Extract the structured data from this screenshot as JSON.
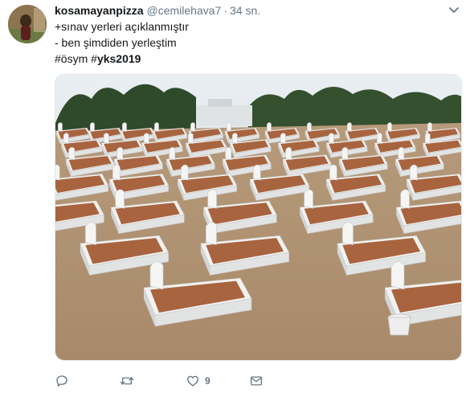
{
  "tweet": {
    "display_name": "kosamayanpizza",
    "handle": "@cemilehava7",
    "separator": "·",
    "time": "34 sn.",
    "lines": [
      "+sınav yerleri açıklanmıştır",
      "- ben şimdiden yerleştim"
    ],
    "hashtags": [
      {
        "hash": "#",
        "text": "ösym"
      },
      {
        "hash": "#",
        "text": "yks2019"
      }
    ]
  },
  "actions": {
    "reply": {
      "icon": "reply-icon",
      "count": ""
    },
    "retweet": {
      "icon": "retweet-icon",
      "count": ""
    },
    "like": {
      "icon": "heart-icon",
      "count": "9"
    },
    "message": {
      "icon": "envelope-icon",
      "count": ""
    }
  },
  "colors": {
    "name": "#14171a",
    "meta": "#657786",
    "border": "#e1e8ed"
  }
}
